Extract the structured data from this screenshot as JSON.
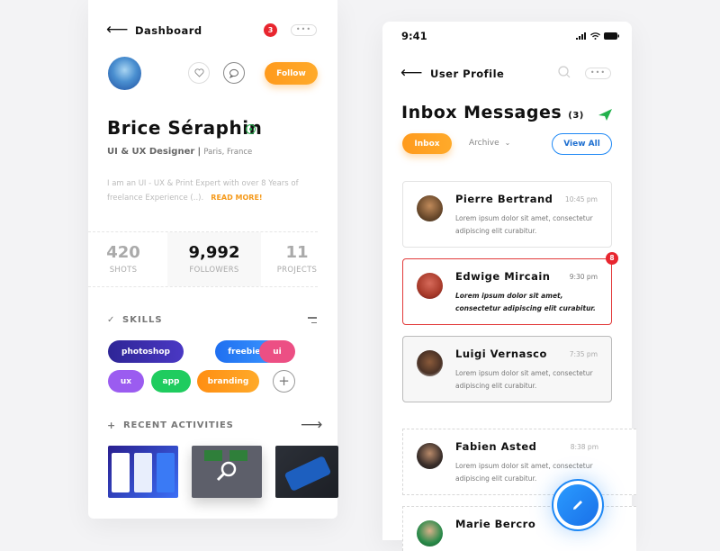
{
  "dashboard": {
    "title": "Dashboard",
    "notification_count": "3",
    "more_label": "•••",
    "follow_label": "Follow",
    "profile": {
      "name": "Brice Séraphin",
      "role": "UI & UX Designer",
      "separator": "|",
      "location": "Paris, France",
      "bio": "I am an UI - UX & Print Expert with over 8 Years of freelance Experience (..).",
      "read_more": "READ MORE!"
    },
    "stats": [
      {
        "value": "420",
        "label": "SHOTS"
      },
      {
        "value": "9,992",
        "label": "FOLLOWERS"
      },
      {
        "value": "11",
        "label": "PROJECTS"
      }
    ],
    "skills": {
      "title": "SKILLS",
      "check": "✓",
      "items": [
        {
          "label": "photoshop",
          "color": "#3a2aa8"
        },
        {
          "label": "freebies",
          "color": "#2a7ef5"
        },
        {
          "label": "ui",
          "color": "#ec4f84"
        },
        {
          "label": "ux",
          "color": "#9b5cf0"
        },
        {
          "label": "app",
          "color": "#1fcc5f"
        },
        {
          "label": "branding",
          "color": "#ff9a1c"
        }
      ],
      "add_label": "+"
    },
    "recent": {
      "plus": "+",
      "title": "RECENT ACTIVITIES",
      "arrow": "⟶"
    }
  },
  "profile_screen": {
    "status_time": "9:41",
    "title": "User Profile",
    "more_label": "•••",
    "inbox": {
      "title": "Inbox Messages",
      "count": "(3)",
      "tabs": {
        "inbox": "Inbox",
        "archive": "Archive",
        "archive_chevron": "⌄"
      },
      "view_all": "View All"
    },
    "messages": [
      {
        "name": "Pierre Bertrand",
        "time": "10:45 pm",
        "text": "Lorem ipsum dolor sit amet, consectetur adipiscing elit curabitur.",
        "avatar": "#6b4a2c"
      },
      {
        "name": "Edwige Mircain",
        "time": "9:30 pm",
        "text": "Lorem ipsum dolor sit amet, consectetur adipiscing elit curabitur.",
        "badge": "8",
        "avatar": "#a83a2a"
      },
      {
        "name": "Luigi Vernasco",
        "time": "7:35 pm",
        "text": "Lorem ipsum dolor sit amet, consectetur adipiscing elit curabitur.",
        "avatar": "#4a3226"
      },
      {
        "name": "Fabien Asted",
        "time": "8:38 pm",
        "text": "Lorem ipsum dolor sit amet, consectetur adipiscing elit curabitur.",
        "avatar": "#3a2e2a"
      },
      {
        "name": "Marie Bercro",
        "avatar": "#2a8a4a"
      }
    ]
  },
  "colors": {
    "orange": "#ff9a1c",
    "blue": "#1e88f5",
    "red": "#e23a3a",
    "green": "#22b14c"
  }
}
